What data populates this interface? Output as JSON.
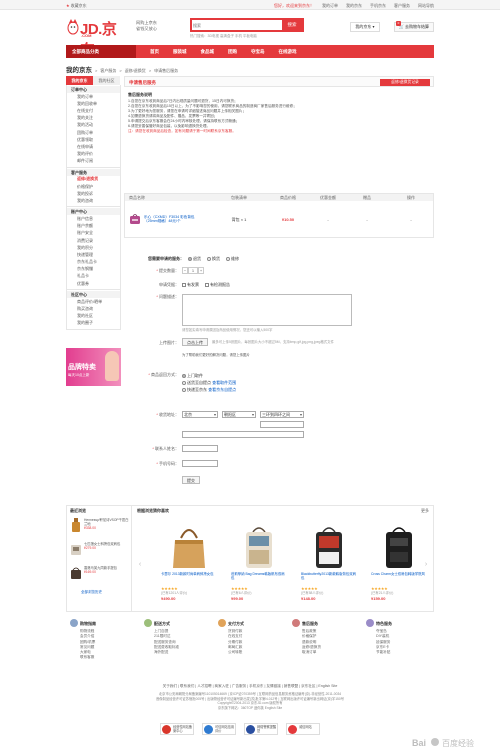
{
  "topbar": {
    "favorite": "收藏京东",
    "user": "您好，欢迎来到京东！",
    "links": [
      "我的订单",
      "我的京东",
      "手机京东",
      "客户服务",
      "网站导航"
    ]
  },
  "header": {
    "logo_text": "JD.京东",
    "logo_sub": ".COM",
    "slogan": [
      "网购上京东",
      "省钱又放心"
    ],
    "search_placeholder": "搜索",
    "search_button": "搜索",
    "hotwords": "热门搜索：3D电视  高清盒子  手机  平板电脑",
    "myjd": "我的京东",
    "cart": "去购物车结算",
    "cart_count": "0"
  },
  "nav": {
    "all_categories": "全部商品分类",
    "items": [
      "首页",
      "服装城",
      "食品城",
      "团购",
      "夺宝岛",
      "在线游戏"
    ]
  },
  "breadcrumb": {
    "title": "我的京东",
    "path": [
      "客户服务",
      "返修/退换货",
      "申请售后服务"
    ]
  },
  "sidebar": {
    "tabs": [
      "我的京东",
      "我的社区"
    ],
    "groups": [
      {
        "title": "订单中心",
        "items": [
          "我的订单",
          "我的回收单",
          "在线支付",
          "我的关注",
          "我的活动",
          "团购订单",
          "优惠领取",
          "在线申请",
          "我的评价",
          "邮件订阅"
        ]
      },
      {
        "title": "客户服务",
        "items": [
          "返修/退换货",
          "价格保护",
          "我的投诉",
          "我的咨询"
        ]
      },
      {
        "title": "账户中心",
        "items": [
          "账户信息",
          "账户余额",
          "账户安全",
          "消费记录",
          "我的积分",
          "快递管理",
          "京东礼品卡",
          "京东钢镚",
          "礼品卡",
          "优惠券"
        ]
      },
      {
        "title": "社区中心",
        "items": [
          "商品评价/晒单",
          "购买咨询",
          "我的社区",
          "我的圈子"
        ]
      }
    ],
    "active_item": "返修/退换货",
    "promo_title": "品牌特卖",
    "promo_sub": "每天10点上新"
  },
  "main": {
    "header_title": "申请售后服务",
    "header_button": "返修/退换货记录",
    "notice_title": "售后服务说明",
    "notice_lines": [
      "1.自您在京东收到商品后7日内出现质量问题可退货，15日内可换货；",
      "2.自您在京东收到商品后15日以上，为了不影响您的使用，请您联系商品的制造商厂家售后服务进行维修；",
      "3.为了更好地为您服务，请您在申请时详细描述商品问题并上传相关图片；",
      "4.如需退换货请将商品及配件、赠品、发票等一并寄回；",
      "5.申请提交后京东客服会在24小时内审核处理，请保持联系方式畅通；",
      "6.请您妥善保管好商品包装，以免影响退换货处理。"
    ],
    "notice_red": "注：请您在收到商品后检查，如有问题请于第一时间联系京东客服。",
    "table_headers": [
      "商品名称",
      "包装清单",
      "商品价格",
      "优惠金额",
      "赠品",
      "操作"
    ],
    "product": {
      "name": "乐心（CXMD）F3034 彩色背包（25mm规格）48元/个",
      "pack": "背包 × 1",
      "price": "¥10.50",
      "discount": "-",
      "gift": "-",
      "action": "-"
    }
  },
  "form": {
    "service_label": "您需要申请的服务：",
    "service_options": [
      "退货",
      "换货",
      "维修"
    ],
    "service_selected": 0,
    "qty_label": "提交数量：",
    "qty_value": "1",
    "qty_hint": "",
    "invoice_label": "申请凭据：",
    "invoice_options": [
      "有发票",
      "有检测报告"
    ],
    "desc_label": "问题描述：",
    "desc_hint": "请您如实填写申请原因及商品使用情况，您还可以输入500字",
    "upload_label": "上传图片：",
    "upload_btn": "点击上传",
    "upload_hint": "为了帮助我们更好的解决问题，请您上传图片",
    "upload_note": "最多可上传5张图片，每张图片大小不超过5M，支持bmp,gif,jpg,png,jpeg格式文件",
    "return_label": "商品返回方式：",
    "return_options": [
      "上门取件",
      "送货至自提点",
      "快递至京东"
    ],
    "return_links": [
      "查看取件范围",
      "查看京东自提点"
    ],
    "address_label": "收货地址：",
    "province": "北京",
    "city": "朝阳区",
    "district": "三环到四环之间",
    "contact_label": "联系人姓名：",
    "phone_label": "手机号码：",
    "submit": "提交"
  },
  "bottom": {
    "browsed_title": "最近浏览",
    "rec_title": "根据浏览猜你喜欢",
    "more": "更多",
    "browsed": [
      {
        "name": "Hennessy/轩尼诗VSOP干邑白兰地",
        "price": "¥338.00"
      },
      {
        "name": "七匹狼女士斜挎包双肩包",
        "price": "¥279.00"
      },
      {
        "name": "香港马英九同款手提包",
        "price": "¥169.00"
      }
    ],
    "browsed_more": "全部浏览历史",
    "goods": [
      {
        "name": "卡瑟尔 2013新款时尚单肩斜挎女包",
        "reviews": "(已有1201人评价)",
        "price": "¥490.00"
      },
      {
        "name": "芭莉菲纳 Bag Dreams韩版帆布双肩包",
        "reviews": "(已有6人评价)",
        "price": "¥99.00"
      },
      {
        "name": "Blackbutterfly2013新款韩版背包双肩包",
        "reviews": "(已有58人评价)",
        "price": "¥148.00"
      },
      {
        "name": "Cross Charm女士双肩包韩版学院风",
        "reviews": "(已有21人评价)",
        "price": "¥159.00"
      }
    ]
  },
  "footer": {
    "columns": [
      {
        "title": "购物指南",
        "items": [
          "购物流程",
          "会员介绍",
          "团购/机票",
          "常见问题",
          "大家电",
          "联系客服"
        ]
      },
      {
        "title": "配送方式",
        "items": [
          "上门自提",
          "211限时达",
          "配送服务查询",
          "配送费收取标准",
          "海外配送"
        ]
      },
      {
        "title": "支付方式",
        "items": [
          "货到付款",
          "在线支付",
          "分期付款",
          "邮局汇款",
          "公司转账"
        ]
      },
      {
        "title": "售后服务",
        "items": [
          "售后政策",
          "价格保护",
          "退款说明",
          "返修/退换货",
          "取消订单"
        ]
      },
      {
        "title": "特色服务",
        "items": [
          "夺宝岛",
          "DIY装机",
          "延保服务",
          "京东E卡",
          "节能补贴"
        ]
      }
    ],
    "links": "关于我们 | 联系我们 | 人才招聘 | 商家入驻 | 广告服务 | 手机京东 | 友情链接 | 销售联盟 | 京东社区 | English Site",
    "copy": [
      "北京市公安局朝阳分局备案编号110105014669 | 京ICP证070359号 | 互联网药品信息服务资格证编号(京)-非经营性-2011-0034",
      "音像制品经营许可证苏宿批005号 | 出版物经营许可证编号新出发(苏)批字第N-012号 | 互联网出版许可证编号新出网证(京)字150号",
      "Copyright©2004-2013  京东JD.com 版权所有",
      "京东旗下网站：360TOP  迷你挑  English Site"
    ],
    "badges": [
      "经营性网站备案中心",
      "可信网站信用评价",
      "网络警察提醒您",
      "诚信网站"
    ]
  },
  "watermark": "Bai 百度经验"
}
